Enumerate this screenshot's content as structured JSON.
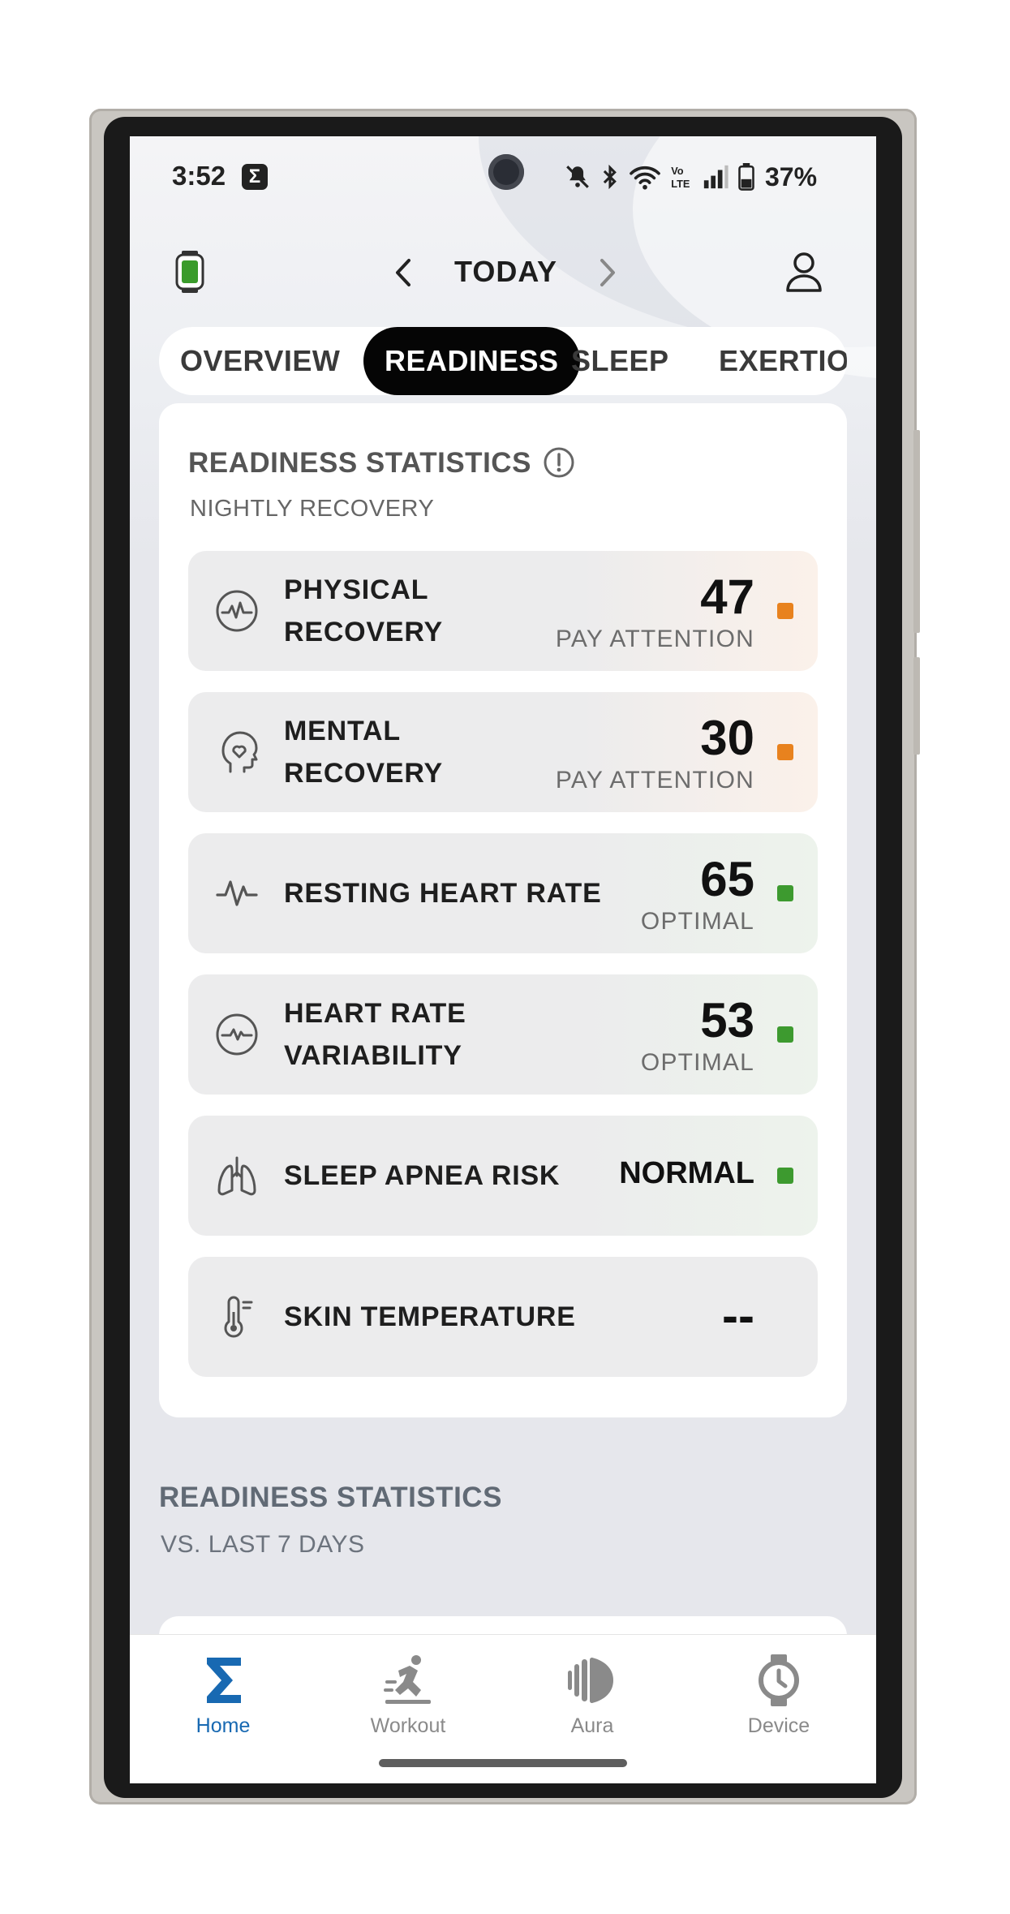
{
  "status_bar": {
    "time": "3:52",
    "battery": "37%"
  },
  "top_nav": {
    "title": "TODAY"
  },
  "tabs": [
    {
      "label": "OVERVIEW"
    },
    {
      "label": "READINESS"
    },
    {
      "label": "SLEEP"
    },
    {
      "label": "EXERTION"
    }
  ],
  "card": {
    "title": "READINESS STATISTICS",
    "subtitle": "NIGHTLY RECOVERY",
    "rows": [
      {
        "label_line1": "PHYSICAL",
        "label_line2": "RECOVERY",
        "value": "47",
        "status": "PAY ATTENTION",
        "color": "#e8821e",
        "icon": "pulse-circle-icon"
      },
      {
        "label_line1": "MENTAL",
        "label_line2": "RECOVERY",
        "value": "30",
        "status": "PAY ATTENTION",
        "color": "#e8821e",
        "icon": "head-heart-icon"
      },
      {
        "label_line1": "RESTING HEART RATE",
        "label_line2": "",
        "value": "65",
        "status": "OPTIMAL",
        "color": "#3d9a2f",
        "icon": "heartbeat-icon"
      },
      {
        "label_line1": "HEART RATE",
        "label_line2": "VARIABILITY",
        "value": "53",
        "status": "OPTIMAL",
        "color": "#3d9a2f",
        "icon": "hrv-circle-icon"
      },
      {
        "label_line1": "SLEEP APNEA RISK",
        "label_line2": "",
        "value": "NORMAL",
        "status": "",
        "color": "#3d9a2f",
        "icon": "lungs-icon"
      },
      {
        "label_line1": "SKIN TEMPERATURE",
        "label_line2": "",
        "value": "--",
        "status": "",
        "color": "",
        "icon": "thermometer-icon"
      }
    ]
  },
  "section2": {
    "title": "READINESS STATISTICS",
    "subtitle": "VS. LAST 7 DAYS"
  },
  "bottom_nav": [
    {
      "label": "Home",
      "icon": "sigma-icon",
      "active": true,
      "color": "#1869b2"
    },
    {
      "label": "Workout",
      "icon": "runner-icon",
      "active": false
    },
    {
      "label": "Aura",
      "icon": "aura-icon",
      "active": false
    },
    {
      "label": "Device",
      "icon": "watch-icon",
      "active": false
    }
  ]
}
